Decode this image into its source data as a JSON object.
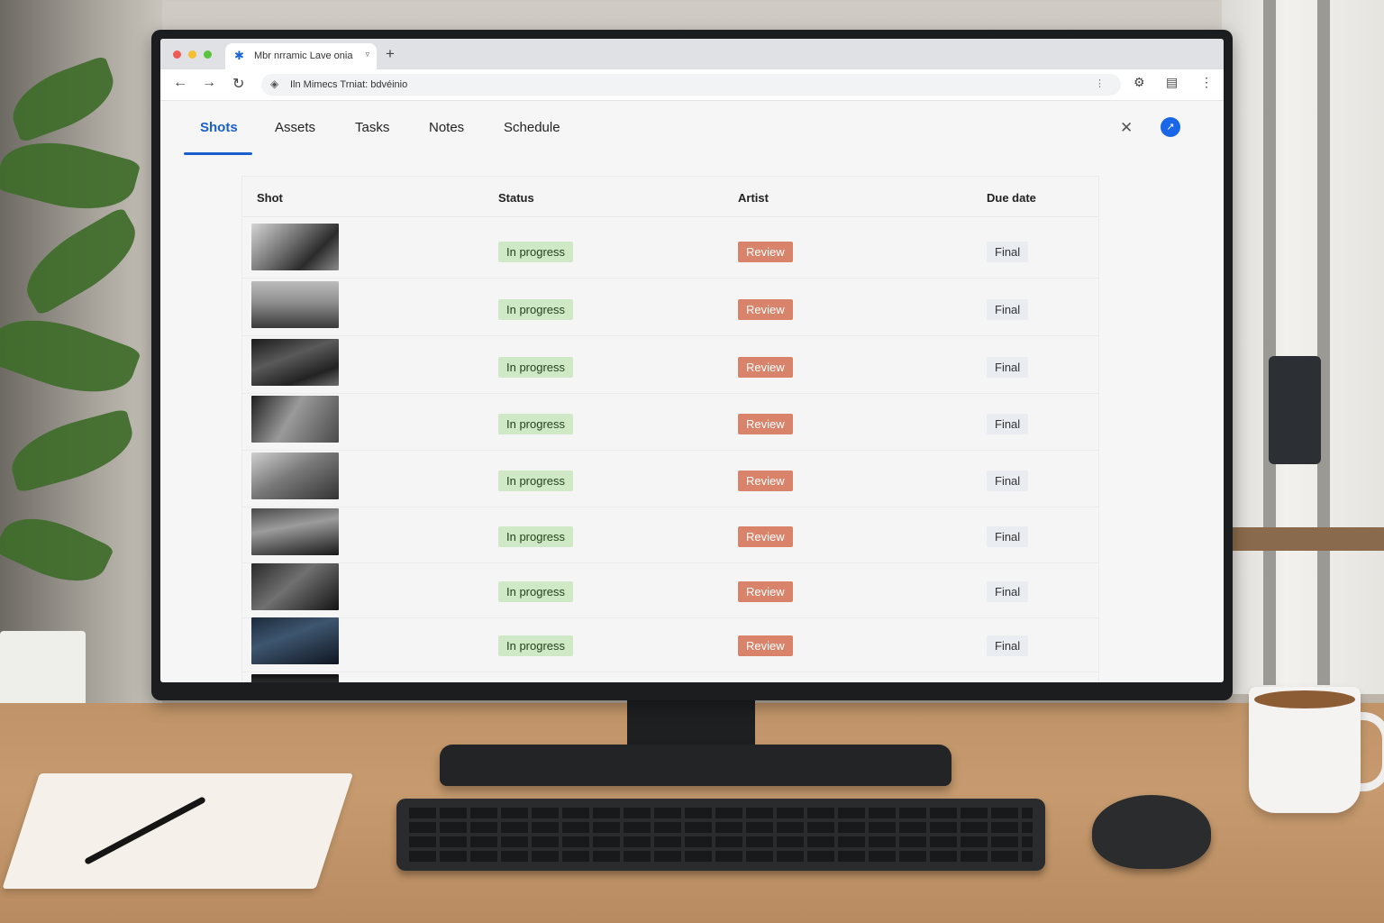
{
  "browser": {
    "tab_title": "Mbr nrramic Lave onia",
    "address": "Iln Mimecs Trniat: bdvéinio"
  },
  "nav": {
    "tabs": [
      {
        "label": "Shots",
        "active": true
      },
      {
        "label": "Assets",
        "active": false
      },
      {
        "label": "Tasks",
        "active": false
      },
      {
        "label": "Notes",
        "active": false
      },
      {
        "label": "Schedule",
        "active": false
      }
    ],
    "avatar_glyph": "↗"
  },
  "table": {
    "columns": [
      "Shot",
      "Status",
      "Artist",
      "Due date"
    ],
    "rows": [
      {
        "status": "In progress",
        "artist": "Review",
        "due": "Final"
      },
      {
        "status": "In progress",
        "artist": "Review",
        "due": "Final"
      },
      {
        "status": "In progress",
        "artist": "Review",
        "due": "Final"
      },
      {
        "status": "In progress",
        "artist": "Review",
        "due": "Final"
      },
      {
        "status": "In progress",
        "artist": "Review",
        "due": "Final"
      },
      {
        "status": "In progress",
        "artist": "Review",
        "due": "Final"
      },
      {
        "status": "In progress",
        "artist": "Review",
        "due": "Final"
      },
      {
        "status": "In progress",
        "artist": "Review",
        "due": "Final"
      }
    ]
  },
  "colors": {
    "accent": "#1b5fcc",
    "status_in_progress_bg": "#cfe8c5",
    "review_bg": "#d9846a",
    "final_bg": "#e9ecf0"
  },
  "icons": {
    "back": "back-arrow-icon",
    "forward": "forward-arrow-icon",
    "reload": "reload-icon",
    "close": "close-icon",
    "settings": "gear-icon",
    "extension": "clipboard-icon",
    "menu": "kebab-menu-icon"
  }
}
